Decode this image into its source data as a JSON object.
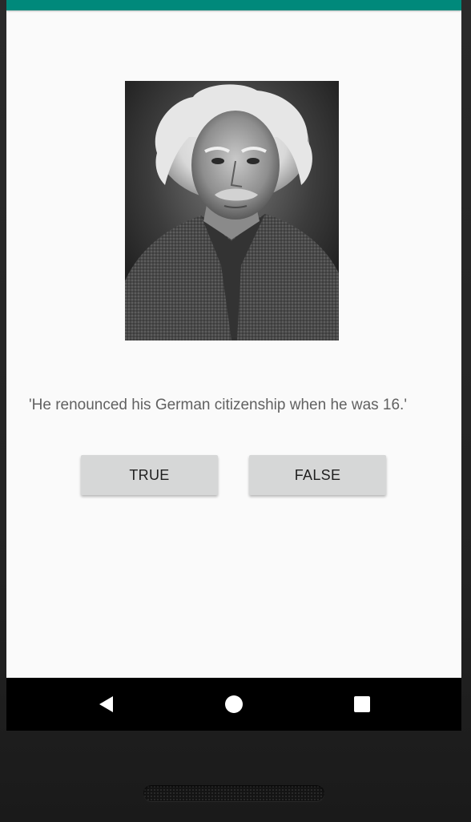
{
  "status_bar": {
    "color": "#00897b"
  },
  "portrait": {
    "description_icon": "portrait-photo"
  },
  "quiz": {
    "question": "'He renounced his German citizenship when he was 16.'",
    "true_label": "TRUE",
    "false_label": "FALSE"
  },
  "navigation": {
    "back_icon": "back-triangle-icon",
    "home_icon": "home-circle-icon",
    "recents_icon": "recents-square-icon"
  },
  "colors": {
    "accent": "#00897b",
    "button_bg": "#d6d7d7",
    "question_text": "#616161",
    "nav_bar": "#000000"
  }
}
